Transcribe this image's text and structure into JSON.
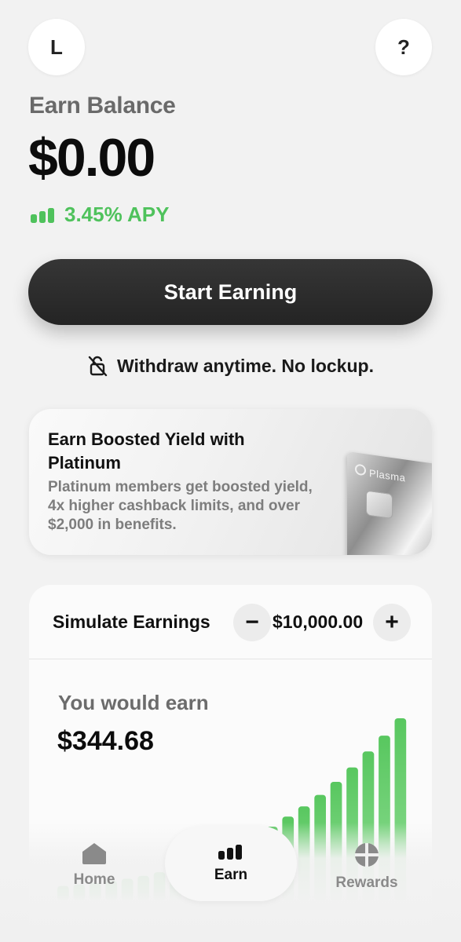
{
  "header": {
    "avatar_letter": "L",
    "help_label": "?"
  },
  "balance": {
    "label": "Earn Balance",
    "amount": "$0.00",
    "apy": "3.45% APY"
  },
  "cta": {
    "label": "Start Earning"
  },
  "withdraw_note": "Withdraw anytime. No lockup.",
  "promo": {
    "title": "Earn Boosted Yield with Platinum",
    "description": "Platinum members get boosted yield, 4x higher cashback limits, and over $2,000 in benefits.",
    "card_brand": "Plasma"
  },
  "simulator": {
    "title": "Simulate Earnings",
    "minus_label": "−",
    "amount": "$10,000.00",
    "plus_label": "+",
    "result_label": "You would earn",
    "result_value": "$344.68",
    "chart_data": {
      "type": "bar",
      "values": [
        1.0,
        1.1,
        1.2,
        1.35,
        1.5,
        1.7,
        1.95,
        2.25,
        2.6,
        3.0,
        3.4,
        3.9,
        4.5,
        5.1,
        5.8,
        6.5,
        7.3,
        8.2,
        9.2,
        10.3,
        11.4,
        12.6
      ]
    }
  },
  "tabs": [
    {
      "label": "Home",
      "icon": "home-icon",
      "active": false
    },
    {
      "label": "Earn",
      "icon": "earn-bars-icon",
      "active": true
    },
    {
      "label": "Rewards",
      "icon": "rewards-icon",
      "active": false
    }
  ],
  "colors": {
    "accent_green": "#4fc25c",
    "button_dark": "#2b2b2b",
    "background": "#f2f2f2"
  }
}
